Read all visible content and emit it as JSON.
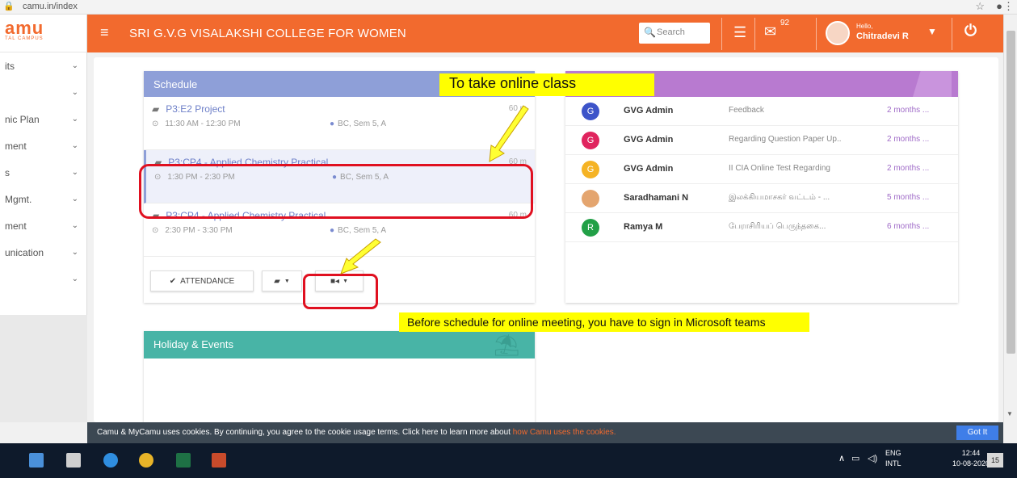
{
  "browser": {
    "url": "camu.in/index"
  },
  "logo": {
    "mark": "amu",
    "sub": "TAL CAMPUS"
  },
  "sidebar": {
    "items": [
      {
        "label": "its"
      },
      {
        "label": ""
      },
      {
        "label": "nic Plan"
      },
      {
        "label": "ment"
      },
      {
        "label": "s"
      },
      {
        "label": "Mgmt."
      },
      {
        "label": "ment"
      },
      {
        "label": "unication"
      },
      {
        "label": ""
      }
    ]
  },
  "header": {
    "college": "SRI G.V.G VISALAKSHI COLLEGE FOR WOMEN",
    "search_placeholder": "Search",
    "mail_count": "92",
    "hello": "Hello,",
    "user_name": "Chitradevi R"
  },
  "schedule": {
    "title": "Schedule",
    "items": [
      {
        "title": "P3:E2 Project",
        "duration": "60 m",
        "time": "11:30 AM - 12:30 PM",
        "location": "BC, Sem 5, A"
      },
      {
        "title": "P3:CP4 - Applied Chemistry Practical",
        "duration": "60 m",
        "time": "1:30 PM - 2:30 PM",
        "location": "BC, Sem 5, A"
      },
      {
        "title": "P3:CP4 - Applied Chemistry Practical",
        "duration": "60 m",
        "time": "2:30 PM - 3:30 PM",
        "location": "BC, Sem 5, A"
      }
    ],
    "attendance_label": "ATTENDANCE"
  },
  "messages": {
    "items": [
      {
        "initial": "G",
        "color": "#3d54c9",
        "name": "GVG Admin",
        "subject": "Feedback",
        "time": "2 months ..."
      },
      {
        "initial": "G",
        "color": "#e0245e",
        "name": "GVG Admin",
        "subject": "Regarding Question Paper Up...",
        "time": "2 months ..."
      },
      {
        "initial": "G",
        "color": "#f5b324",
        "name": "GVG Admin",
        "subject": "II CIA Online Test Regarding",
        "time": "2 months ..."
      },
      {
        "initial": "",
        "color": "#e4a56f",
        "name": "Saradhamani N",
        "subject": "இலக்கியமாசகர் வட்டம் - ...",
        "time": "5 months ..."
      },
      {
        "initial": "R",
        "color": "#22a047",
        "name": "Ramya M",
        "subject": "பேராசிரியப் பெருந்தகை...",
        "time": "6 months ..."
      }
    ]
  },
  "holiday": {
    "title": "Holiday & Events"
  },
  "annotations": {
    "online": "To take online class",
    "before": "Before schedule for online meeting, you have to sign in Microsoft teams"
  },
  "cookie": {
    "text": "Camu & MyCamu uses cookies. By continuing, you agree to the cookie usage terms. Click here to learn more about ",
    "link": "how Camu uses the cookies.",
    "button": "Got It"
  },
  "taskbar": {
    "lang1": "ENG",
    "lang2": "INTL",
    "time": "12:44",
    "date": "10-08-2020",
    "notif_count": "15"
  },
  "colors": {
    "header": "#f26a2e",
    "schedule_header": "#8e9fd8",
    "messages_header": "#b87ad0",
    "holiday_header": "#48b4a6",
    "annotation_fill": "#ffff00",
    "annotation_stroke": "#e01020"
  }
}
